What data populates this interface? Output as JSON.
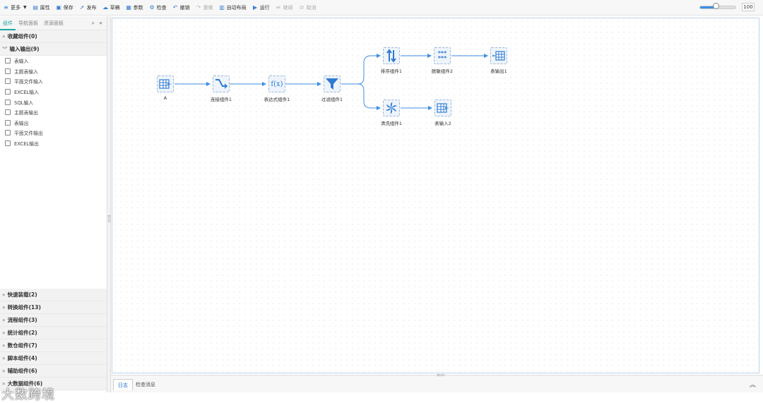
{
  "toolbar": {
    "items": [
      {
        "label": "更多",
        "icon": "menu-icon",
        "caret": "▼",
        "disabled": false
      },
      {
        "label": "属性",
        "icon": "properties-icon",
        "disabled": false
      },
      {
        "label": "保存",
        "icon": "save-icon",
        "disabled": false
      },
      {
        "label": "发布",
        "icon": "publish-icon",
        "disabled": false
      },
      {
        "label": "草稿",
        "icon": "draft-icon",
        "disabled": false
      },
      {
        "label": "参数",
        "icon": "parameters-icon",
        "disabled": false
      },
      {
        "label": "检查",
        "icon": "check-icon",
        "disabled": false
      },
      {
        "label": "撤销",
        "icon": "undo-icon",
        "disabled": false
      },
      {
        "label": "重做",
        "icon": "redo-icon",
        "disabled": true
      },
      {
        "label": "自动布局",
        "icon": "auto-layout-icon",
        "disabled": false
      },
      {
        "label": "运行",
        "icon": "run-icon",
        "disabled": false
      },
      {
        "label": "继续",
        "icon": "continue-icon",
        "disabled": true
      },
      {
        "label": "取消",
        "icon": "cancel-icon",
        "disabled": true
      }
    ],
    "zoom_value": "100",
    "zoom_level": 0.45
  },
  "left_panel": {
    "tabs": [
      "组件",
      "导航面板",
      "资源面板"
    ],
    "active_tab": 0,
    "groups_top": [
      {
        "label": "收藏组件(0)",
        "expanded": false
      },
      {
        "label": "输入输出(9)",
        "expanded": true
      }
    ],
    "items": [
      "表输入",
      "主题表输入",
      "平面文件输入",
      "EXCEL输入",
      "SQL输入",
      "主题表输出",
      "表输出",
      "平面文件输出",
      "EXCEL输出"
    ],
    "groups_bottom": [
      "快速装载(2)",
      "转换组件(13)",
      "流程组件(3)",
      "统计组件(2)",
      "数仓组件(7)",
      "脚本组件(4)",
      "辅助组件(6)",
      "大数据组件(6)"
    ],
    "watermark": "大数跨境"
  },
  "canvas": {
    "nodes": [
      {
        "id": "A",
        "label": "A",
        "icon": "table-input-icon"
      },
      {
        "id": "n1",
        "label": "连接组件1",
        "icon": "join-icon"
      },
      {
        "id": "n2",
        "label": "表达式组件1",
        "icon": "expression-icon",
        "glyph": "f(x)"
      },
      {
        "id": "n3",
        "label": "过滤组件1",
        "icon": "filter-icon"
      },
      {
        "id": "n4",
        "label": "排序组件1",
        "icon": "sort-icon"
      },
      {
        "id": "n5",
        "label": "脱敏组件2",
        "icon": "mask-icon",
        "glyph": "***"
      },
      {
        "id": "n6",
        "label": "表输出1",
        "icon": "table-output-icon"
      },
      {
        "id": "n7",
        "label": "清洗组件1",
        "icon": "cleanse-icon"
      },
      {
        "id": "n8",
        "label": "表输入2",
        "icon": "table-input-icon"
      }
    ]
  },
  "bottom_bar": {
    "tabs": [
      "日志",
      "检查消息"
    ],
    "active_tab": 0
  }
}
